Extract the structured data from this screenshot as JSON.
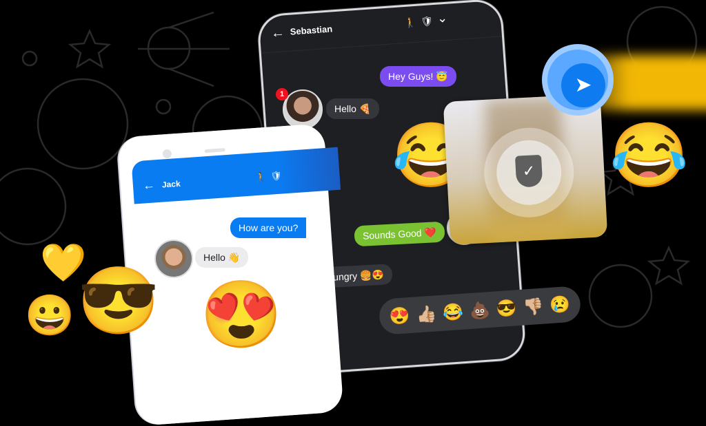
{
  "dark_chat": {
    "contact_name": "Sebastian",
    "back_icon": "←",
    "header_icons": [
      "🚶",
      "🛡",
      "⌄"
    ],
    "unread_badge": "1",
    "messages": [
      {
        "from": "me",
        "text": "Hey Guys! 😇",
        "color": "#7b4cf0"
      },
      {
        "from": "them",
        "text": "Hello 🍕",
        "color": "#35363b"
      },
      {
        "from": "me",
        "text": "Sounds Good ❤️",
        "color": "#7ac232"
      },
      {
        "from": "them",
        "text": "Hungry 🍔😍",
        "color": "#35363b"
      }
    ],
    "big_emoji": "😂"
  },
  "light_chat": {
    "contact_name": "Jack",
    "back_icon": "←",
    "header_icons": [
      "🚶",
      "🛡"
    ],
    "header_color": "#0a7cf2",
    "messages": [
      {
        "from": "me",
        "text": "How are you?",
        "color": "#0a7cf2"
      },
      {
        "from": "them",
        "text": "Hello 👋",
        "color": "#ececef"
      }
    ],
    "big_emoji": "😍"
  },
  "reactions": [
    "😍",
    "👍🏼",
    "😂",
    "💩",
    "😎",
    "👎🏼",
    "😢"
  ],
  "floating": {
    "send_icon": "➤",
    "shield_icon": "🛡",
    "heart": "💛",
    "emojis": [
      "😂",
      "😎",
      "😀"
    ]
  }
}
